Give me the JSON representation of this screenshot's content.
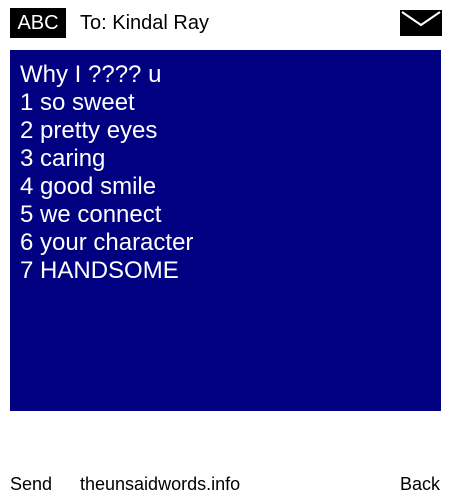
{
  "header": {
    "mode": "ABC",
    "to_label": "To:",
    "recipient": "Kindal Ray",
    "icon": "envelope-icon"
  },
  "message": {
    "lines": [
      "Why I ???? u",
      "1 so sweet",
      "2 pretty eyes",
      "3 caring",
      "4 good smile",
      "5 we connect",
      "6 your character",
      "7 HANDSOME"
    ],
    "background": "#000080",
    "text_color": "#ffffff"
  },
  "footer": {
    "left_softkey": "Send",
    "site": "theunsaidwords.info",
    "right_softkey": "Back"
  }
}
